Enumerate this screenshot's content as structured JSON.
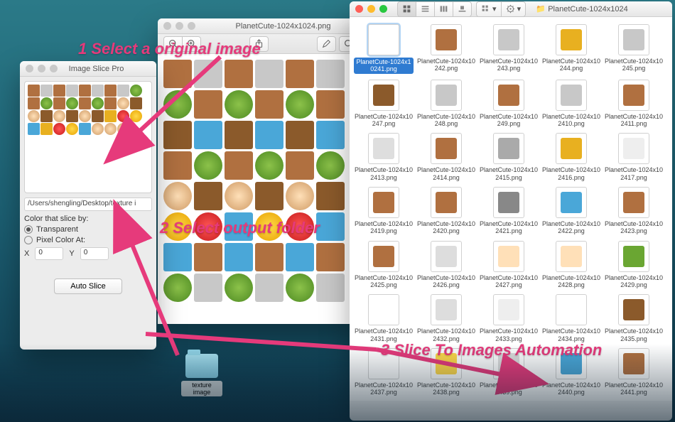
{
  "slice": {
    "title": "Image Slice Pro",
    "path": "/Users/shengling/Desktop/texture i",
    "group_label": "Color that slice by:",
    "radio_transparent": "Transparent",
    "radio_pixel": "Pixel Color At:",
    "x_label": "X",
    "x_val": "0",
    "y_label": "Y",
    "y_val": "0",
    "button": "Auto Slice",
    "preview_tiles": [
      "brick",
      "stone",
      "brick",
      "stone",
      "brick",
      "stone",
      "brick",
      "stone",
      "grass",
      "brick",
      "grass",
      "brick",
      "grass",
      "brick",
      "grass",
      "brick",
      "face",
      "chest",
      "face",
      "chest",
      "face",
      "chest",
      "face",
      "chest",
      "key",
      "heart",
      "star",
      "water",
      "key",
      "heart",
      "star",
      "water",
      "face",
      "face",
      "face",
      "blank",
      "blank",
      "blank",
      "blank",
      "blank",
      "blank",
      "blank",
      "blank",
      "blank",
      "blank",
      "blank",
      "blank",
      "blank"
    ]
  },
  "preview": {
    "title": "PlanetCute-1024x1024.png",
    "tiles": [
      "brick",
      "stone",
      "brick",
      "stone",
      "brick",
      "stone",
      "grass",
      "brick",
      "grass",
      "brick",
      "grass",
      "brick",
      "chest",
      "water",
      "chest",
      "water",
      "chest",
      "water",
      "brick",
      "grass",
      "brick",
      "grass",
      "brick",
      "grass",
      "face",
      "chest",
      "face",
      "chest",
      "face",
      "chest",
      "star",
      "heart",
      "water",
      "star",
      "heart",
      "water",
      "water",
      "brick",
      "water",
      "brick",
      "water",
      "brick",
      "grass",
      "stone",
      "grass",
      "stone",
      "grass",
      "stone"
    ]
  },
  "finder": {
    "title": "PlanetCute-1024x1024",
    "selected_index": 0,
    "items": [
      {
        "n": "PlanetCute-1024x10241.png",
        "c": "#fff"
      },
      {
        "n": "PlanetCute-1024x10242.png",
        "c": "#b07040"
      },
      {
        "n": "PlanetCute-1024x10243.png",
        "c": "#c8c8c8"
      },
      {
        "n": "PlanetCute-1024x10244.png",
        "c": "#e8b020"
      },
      {
        "n": "PlanetCute-1024x10245.png",
        "c": "#c8c8c8"
      },
      {
        "n": "PlanetCute-1024x10247.png",
        "c": "#8b5a2b"
      },
      {
        "n": "PlanetCute-1024x10248.png",
        "c": "#c8c8c8"
      },
      {
        "n": "PlanetCute-1024x10249.png",
        "c": "#b07040"
      },
      {
        "n": "PlanetCute-1024x102410.png",
        "c": "#c8c8c8"
      },
      {
        "n": "PlanetCute-1024x102411.png",
        "c": "#b07040"
      },
      {
        "n": "PlanetCute-1024x102413.png",
        "c": "#dedede"
      },
      {
        "n": "PlanetCute-1024x102414.png",
        "c": "#b07040"
      },
      {
        "n": "PlanetCute-1024x102415.png",
        "c": "#aaaaaa"
      },
      {
        "n": "PlanetCute-1024x102416.png",
        "c": "#e8b020"
      },
      {
        "n": "PlanetCute-1024x102417.png",
        "c": "#eeeeee"
      },
      {
        "n": "PlanetCute-1024x102419.png",
        "c": "#b07040"
      },
      {
        "n": "PlanetCute-1024x102420.png",
        "c": "#b07040"
      },
      {
        "n": "PlanetCute-1024x102421.png",
        "c": "#888888"
      },
      {
        "n": "PlanetCute-1024x102422.png",
        "c": "#4aa7d8"
      },
      {
        "n": "PlanetCute-1024x102423.png",
        "c": "#b07040"
      },
      {
        "n": "PlanetCute-1024x102425.png",
        "c": "#b07040"
      },
      {
        "n": "PlanetCute-1024x102426.png",
        "c": "#dddddd"
      },
      {
        "n": "PlanetCute-1024x102427.png",
        "c": "#ffe0b8"
      },
      {
        "n": "PlanetCute-1024x102428.png",
        "c": "#ffe0b8"
      },
      {
        "n": "PlanetCute-1024x102429.png",
        "c": "#6aa632"
      },
      {
        "n": "PlanetCute-1024x102431.png",
        "c": "#fff"
      },
      {
        "n": "PlanetCute-1024x102432.png",
        "c": "#dddddd"
      },
      {
        "n": "PlanetCute-1024x102433.png",
        "c": "#eeeeee"
      },
      {
        "n": "PlanetCute-1024x102434.png",
        "c": "#fff"
      },
      {
        "n": "PlanetCute-1024x102435.png",
        "c": "#8b5a2b"
      },
      {
        "n": "PlanetCute-1024x102437.png",
        "c": "#fff"
      },
      {
        "n": "PlanetCute-1024x102438.png",
        "c": "#ffd94a"
      },
      {
        "n": "PlanetCute-1024x102439.png",
        "c": "#dddddd"
      },
      {
        "n": "PlanetCute-1024x102440.png",
        "c": "#4aa7d8"
      },
      {
        "n": "PlanetCute-1024x102441.png",
        "c": "#b07040"
      }
    ]
  },
  "desktop": {
    "folder_name": "texture image"
  },
  "annotations": {
    "a1": "1 Select a original image",
    "a2": "2 Select output folder",
    "a3": "3 Slice To Images Automation"
  }
}
